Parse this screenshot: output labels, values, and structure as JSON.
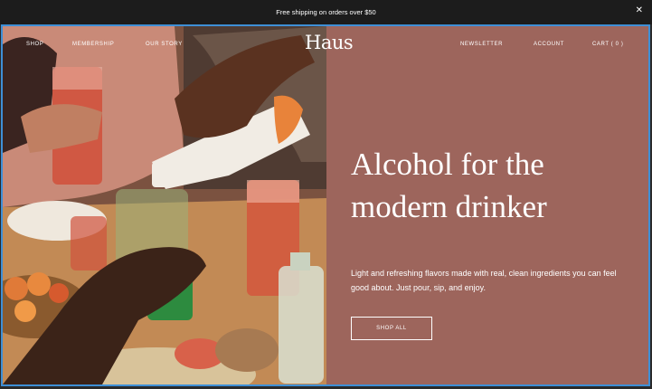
{
  "announcement": {
    "text": "Free shipping on orders over $50",
    "close": "✕"
  },
  "nav": {
    "left": [
      "SHOP",
      "MEMBERSHIP",
      "OUR STORY"
    ],
    "logo": "Haus",
    "right": [
      "NEWSLETTER",
      "ACCOUNT",
      "CART ( 0 )"
    ]
  },
  "hero": {
    "headline_line1": "Alcohol for the",
    "headline_line2": "modern drinker",
    "subtext": "Light and refreshing flavors made with real, clean ingredients you can feel good about. Just pour, sip, and enjoy.",
    "cta": "SHOP ALL",
    "image": "photo-of-friends-pouring-drinks"
  },
  "colors": {
    "panel": "#9d655c",
    "announcement_bg": "#1c1c1c",
    "focus_outline": "#3e8fd6"
  }
}
